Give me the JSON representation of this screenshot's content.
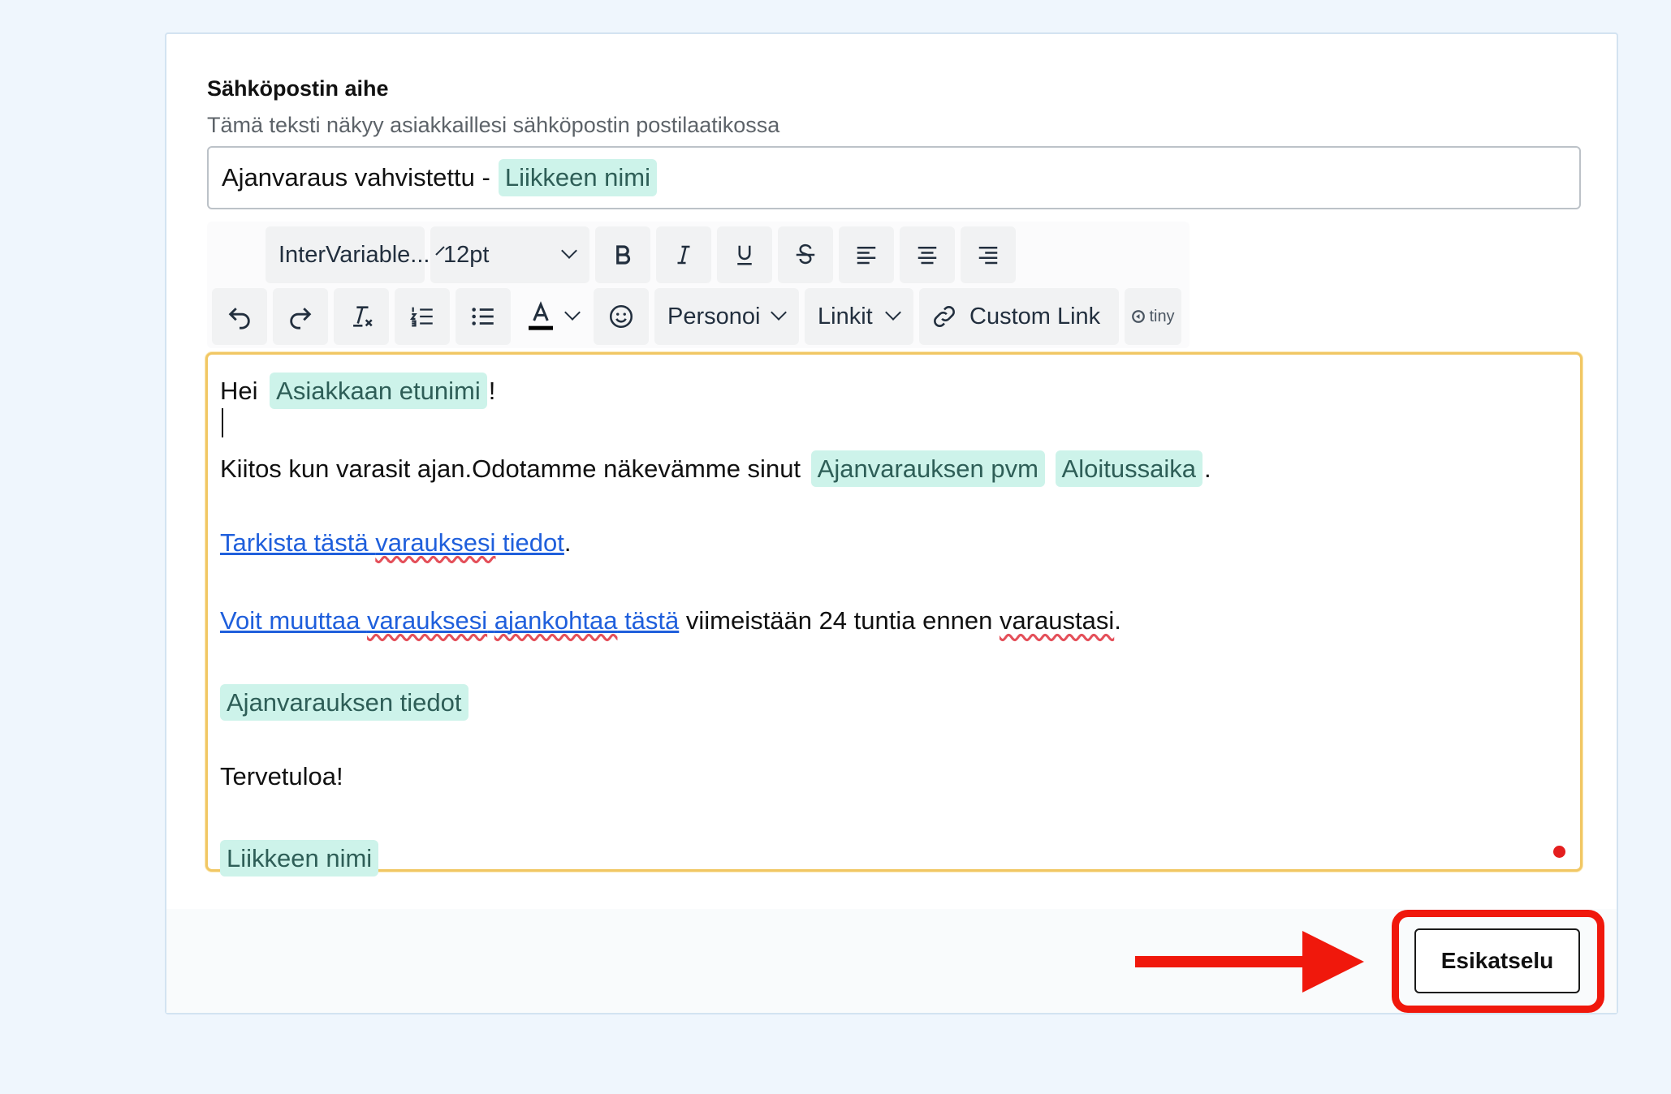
{
  "form": {
    "subject_title": "Sähköpostin aihe",
    "subject_help": "Tämä teksti näkyy asiakkaillesi sähköpostin postilaatikossa",
    "subject_text": "Ajanvaraus vahvistettu -",
    "subject_chip": "Liikkeen nimi"
  },
  "toolbar": {
    "font_family": "InterVariable...",
    "font_size": "12pt",
    "personalize_label": "Personoi",
    "links_label": "Linkit",
    "custom_link_label": "Custom Link",
    "tiny_label": "tiny",
    "text_color": "#000000"
  },
  "editor": {
    "greeting": "Hei",
    "chip_first_name": "Asiakkaan etunimi",
    "greeting_end": "!",
    "thanks_text": "Kiitos kun varasit ajan.Odotamme näkevämme sinut",
    "chip_date": "Ajanvarauksen pvm",
    "chip_start": "Aloitussaika",
    "period": ".",
    "link1_a": "Tarkista tästä ",
    "link1_b": "varauksesi",
    "link1_c": " tiedot",
    "link1_end": ".",
    "link2_a": "Voit muuttaa ",
    "link2_b": "varauksesi",
    "link2_c": " ",
    "link2_d": "ajankohtaa",
    "link2_e": " tästä",
    "deadline_a": " viimeistään 24 tuntia ennen ",
    "deadline_b": "varaustasi",
    "deadline_c": ".",
    "chip_details": "Ajanvarauksen tiedot",
    "welcome": "Tervetuloa!",
    "chip_business": "Liikkeen nimi"
  },
  "actions": {
    "preview_label": "Esikatselu"
  },
  "colors": {
    "chip_bg": "#cdf3ea",
    "editor_focus_border": "#f1c764",
    "annotation_red": "#f0180c",
    "link": "#1f5fdc"
  }
}
